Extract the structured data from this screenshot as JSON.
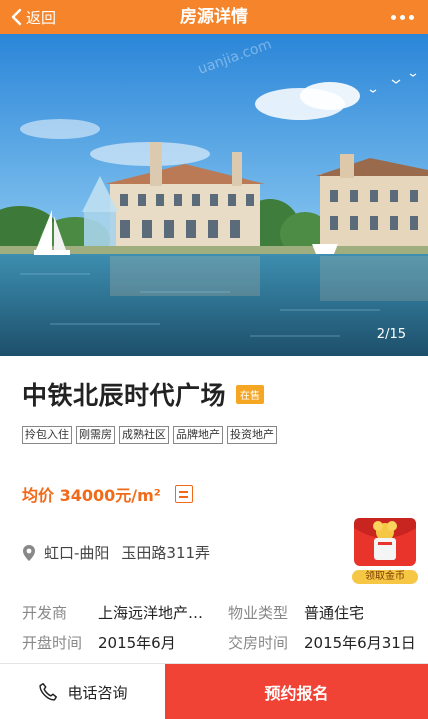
{
  "header": {
    "back_label": "返回",
    "title": "房源详情",
    "background": "#f5842a"
  },
  "hero": {
    "pager": "2/15",
    "watermark": "uanjia.com"
  },
  "listing": {
    "name": "中铁北辰时代广场",
    "status": "在售",
    "tags": [
      "拎包入住",
      "刚需房",
      "成熟社区",
      "品牌地产",
      "投资地产"
    ],
    "price": "均价 34000元/m²",
    "location": {
      "district": "虹口-曲阳",
      "address": "玉田路311弄"
    },
    "gift_label": "领取金币",
    "info": [
      {
        "k1": "开发商",
        "v1": "上海远洋地产…",
        "k2": "物业类型",
        "v2": "普通住宅"
      },
      {
        "k1": "开盘时间",
        "v1": "2015年6月",
        "k2": "交房时间",
        "v2": "2015年6月31日"
      }
    ]
  },
  "bottom": {
    "phone_label": "电话咨询",
    "reserve_label": "预约报名",
    "reserve_color": "#f04336"
  },
  "icons": [
    "chevron-left-icon",
    "more-dots-icon",
    "calculator-icon",
    "location-pin-icon",
    "red-packet-icon",
    "phone-icon"
  ]
}
